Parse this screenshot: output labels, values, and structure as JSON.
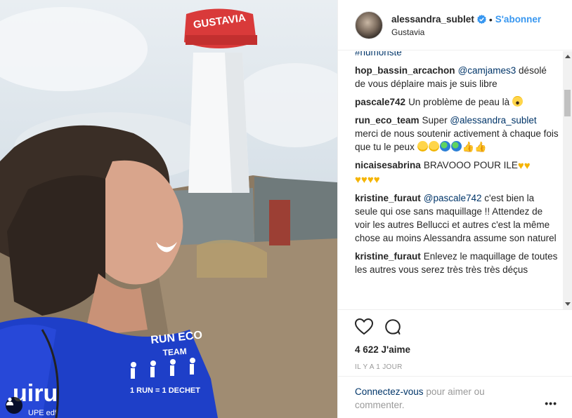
{
  "header": {
    "username": "alessandra_sublet",
    "separator": "•",
    "follow_label": "S'abonner",
    "location": "Gustavia"
  },
  "photo": {
    "tower_sign": "GUSTAVIA",
    "shirt_text_1": "RUN ECO",
    "shirt_text_2": "TEAM",
    "shirt_text_3": "1 RUN = 1 DECHET",
    "shirt_text_4": "uiru",
    "shirt_text_5": "UPE edf"
  },
  "comments": [
    {
      "user": "",
      "text": "#humoriste",
      "is_hashtag": true
    },
    {
      "user": "hop_bassin_arcachon",
      "mention": "@camjames3",
      "text": " désolé de vous déplaire mais je suis libre"
    },
    {
      "user": "pascale742",
      "text": "Un problème de peau là "
    },
    {
      "user": "run_eco_team",
      "pre": "Super ",
      "mention": "@alessandra_sublet",
      "text": " merci de nous soutenir activement à chaque fois que tu le peux "
    },
    {
      "user": "nicaisesabrina",
      "text": "BRAVOOO POUR ILE"
    },
    {
      "user": "kristine_furaut",
      "mention": "@pascale742",
      "text": " c'est bien la seule qui ose sans maquillage !! Attendez de voir les autres Bellucci et autres c'est la même chose au moins Alessandra assume son naturel"
    },
    {
      "user": "kristine_furaut",
      "text": "Enlevez le maquillage de toutes les autres vous serez très très très déçus"
    }
  ],
  "actions": {
    "likes": "4 622 J'aime",
    "timestamp": "IL Y A 1 JOUR"
  },
  "footer": {
    "login_link": "Connectez-vous",
    "login_rest": " pour aimer ou commenter.",
    "more": "•••"
  },
  "colors": {
    "accent": "#3897f0",
    "link": "#003569",
    "muted": "#999999",
    "tower_red": "#d93a3a",
    "shirt_blue": "#1e3fc8"
  },
  "icons": [
    "verified-badge-icon",
    "heart-icon",
    "comment-bubble-icon",
    "user-tag-icon",
    "more-options-icon"
  ]
}
